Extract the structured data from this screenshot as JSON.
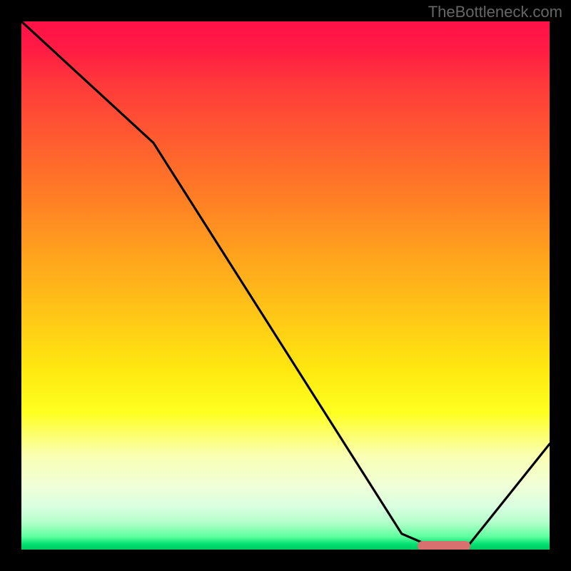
{
  "watermark": "TheBottleneck.com",
  "chart_data": {
    "type": "line",
    "title": "",
    "xlabel": "",
    "ylabel": "",
    "xlim": [
      0,
      100
    ],
    "ylim": [
      0,
      100
    ],
    "background": "rainbow-gradient-vertical",
    "series": [
      {
        "name": "bottleneck-curve",
        "x": [
          0,
          25,
          72,
          79,
          84,
          100
        ],
        "values": [
          100,
          77,
          3,
          0,
          0,
          20
        ]
      }
    ],
    "marker": {
      "x_start": 75,
      "x_end": 85,
      "y": 0,
      "color": "#d87070"
    },
    "gradient_stops": [
      {
        "pos": 0,
        "color": "#ff1248"
      },
      {
        "pos": 0.25,
        "color": "#ff6028"
      },
      {
        "pos": 0.5,
        "color": "#ffb818"
      },
      {
        "pos": 0.75,
        "color": "#ffff20"
      },
      {
        "pos": 0.95,
        "color": "#c0ffd0"
      },
      {
        "pos": 1.0,
        "color": "#00c860"
      }
    ]
  }
}
